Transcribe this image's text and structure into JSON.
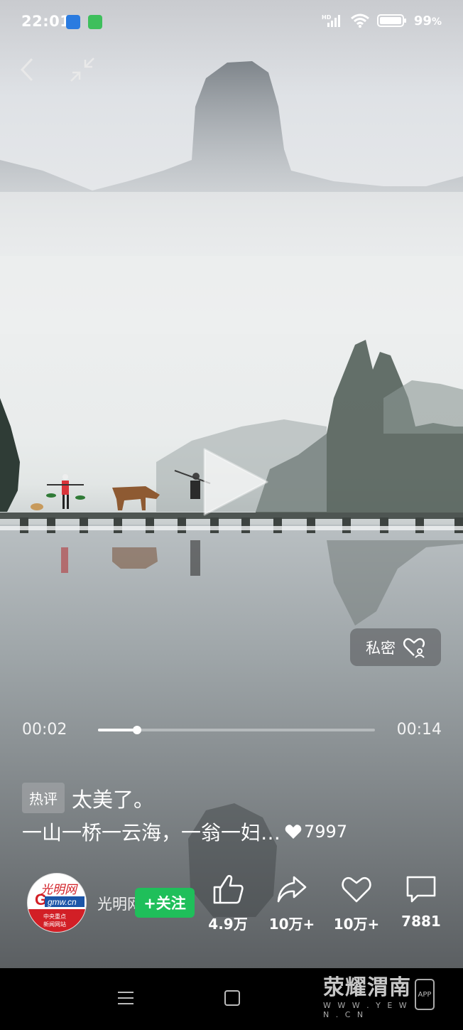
{
  "status_bar": {
    "time": "22:01",
    "battery": "99",
    "battery_unit": "%",
    "network_label": "HD"
  },
  "top_controls": {
    "back_icon": "chevron-left",
    "minimize_icon": "collapse-arrows"
  },
  "video": {
    "private_label": "私密",
    "current_time": "00:02",
    "total_time": "00:14",
    "progress_fraction": 0.14
  },
  "hot_comment": {
    "tag": "热评",
    "text": "太美了。"
  },
  "caption": {
    "text": "一山一桥一云海，一翁一妇…",
    "likes": "7997"
  },
  "author": {
    "name": "光明网",
    "follow_label": "+关注",
    "avatar_logo": "光明网",
    "avatar_domain": "gmw.cn",
    "avatar_sub1": "中央重点",
    "avatar_sub2": "新闻网站"
  },
  "actions": {
    "like_count": "4.9万",
    "share_count": "10万+",
    "favorite_count": "10万+",
    "comment_count": "7881"
  },
  "nav": {
    "watermark_title": "荥耀渭南",
    "watermark_url": "W W W . Y E W N . C N",
    "watermark_app": "APP"
  },
  "colors": {
    "follow_green": "#1fbf5a",
    "nav_background": "#000000"
  }
}
